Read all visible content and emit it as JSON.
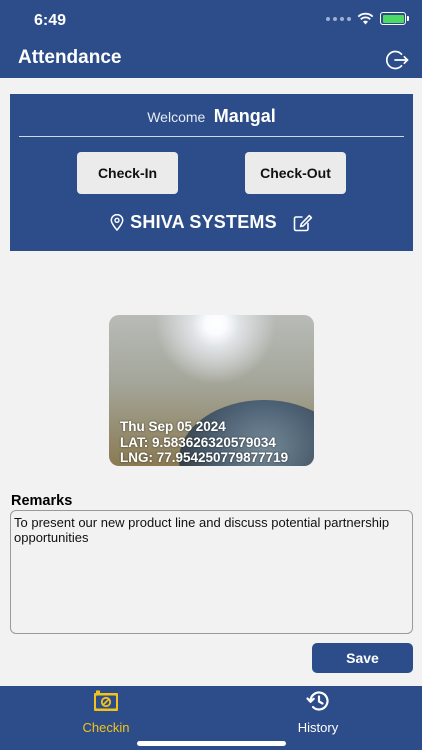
{
  "status_bar": {
    "time": "6:49"
  },
  "header": {
    "title": "Attendance"
  },
  "welcome": {
    "label": "Welcome",
    "name": "Mangal"
  },
  "actions": {
    "check_in": "Check-In",
    "check_out": "Check-Out"
  },
  "company": {
    "name": "SHIVA SYSTEMS"
  },
  "photo": {
    "date": "Thu Sep 05 2024",
    "lat": "LAT: 9.583626320579034",
    "lng": "LNG: 77.954250779877719"
  },
  "remarks": {
    "label": "Remarks",
    "value": "To present our new product line and discuss potential partnership opportunities"
  },
  "save_label": "Save",
  "tabs": [
    {
      "label": "Checkin",
      "active": true,
      "icon": "camera-icon"
    },
    {
      "label": "History",
      "active": false,
      "icon": "history-icon"
    }
  ],
  "colors": {
    "primary": "#2c4d8a",
    "active_tab": "#f2c21b",
    "background": "#f2f2f2"
  }
}
